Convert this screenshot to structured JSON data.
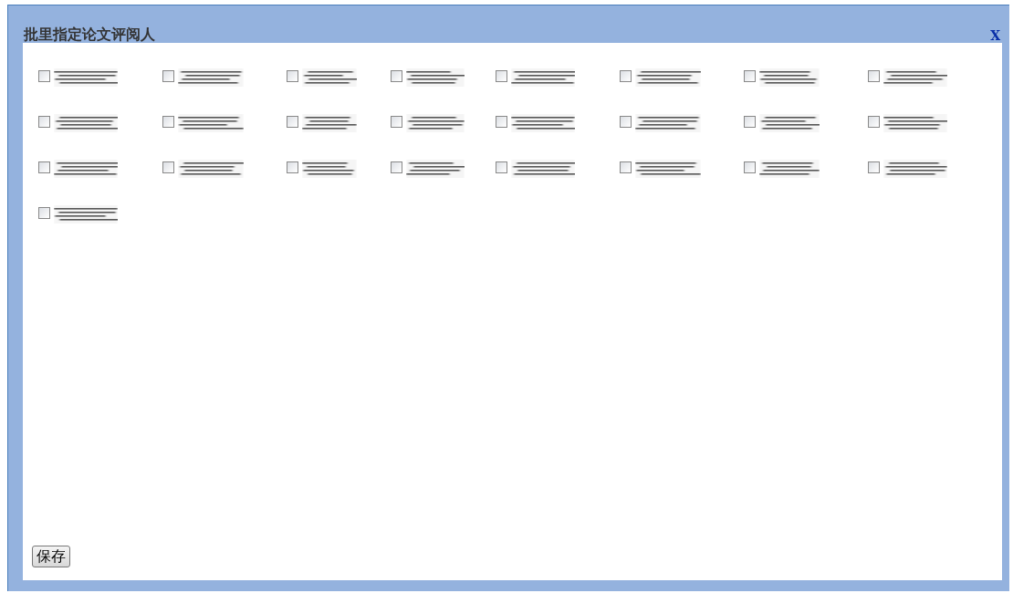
{
  "dialog": {
    "title": "批里指定论文评阅人",
    "close": "X"
  },
  "reviewers": [
    {
      "checked": false
    },
    {
      "checked": false
    },
    {
      "checked": false
    },
    {
      "checked": false
    },
    {
      "checked": false
    },
    {
      "checked": false
    },
    {
      "checked": false
    },
    {
      "checked": false
    },
    {
      "checked": false
    },
    {
      "checked": false
    },
    {
      "checked": false
    },
    {
      "checked": false
    },
    {
      "checked": false
    },
    {
      "checked": false
    },
    {
      "checked": false
    },
    {
      "checked": false
    },
    {
      "checked": false
    },
    {
      "checked": false
    },
    {
      "checked": false
    },
    {
      "checked": false
    },
    {
      "checked": false
    },
    {
      "checked": false
    },
    {
      "checked": false
    },
    {
      "checked": false
    },
    {
      "checked": false
    }
  ],
  "buttons": [
    {
      "label": "保存"
    }
  ]
}
